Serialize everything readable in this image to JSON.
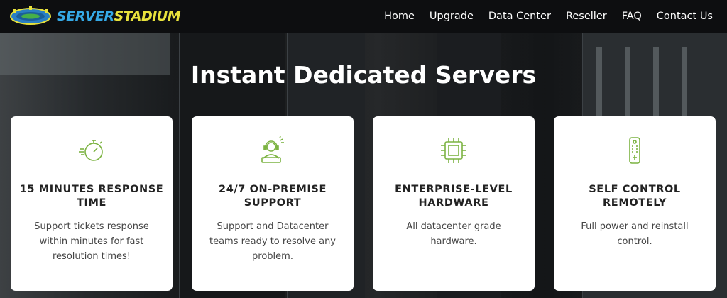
{
  "brand": {
    "part1": "SERVER",
    "part2": "STADIUM"
  },
  "nav": {
    "items": [
      {
        "label": "Home"
      },
      {
        "label": "Upgrade"
      },
      {
        "label": "Data Center"
      },
      {
        "label": "Reseller"
      },
      {
        "label": "FAQ"
      },
      {
        "label": "Contact Us"
      }
    ]
  },
  "hero": {
    "title": "Instant Dedicated Servers"
  },
  "features": [
    {
      "icon": "stopwatch-icon",
      "title": "15 MINUTES RESPONSE TIME",
      "description": "Support tickets response within minutes for fast resolution times!"
    },
    {
      "icon": "support-agent-icon",
      "title": "24/7 ON-PREMISE SUPPORT",
      "description": "Support and Datacenter teams ready to resolve any problem."
    },
    {
      "icon": "cpu-chip-icon",
      "title": "ENTERPRISE-LEVEL HARDWARE",
      "description": "All datacenter grade hardware."
    },
    {
      "icon": "remote-control-icon",
      "title": "SELF CONTROL REMOTELY",
      "description": "Full power and reinstall control."
    }
  ],
  "colors": {
    "accent_green": "#7cb342",
    "brand_blue": "#35a9e6",
    "brand_yellow": "#e8e23c"
  }
}
